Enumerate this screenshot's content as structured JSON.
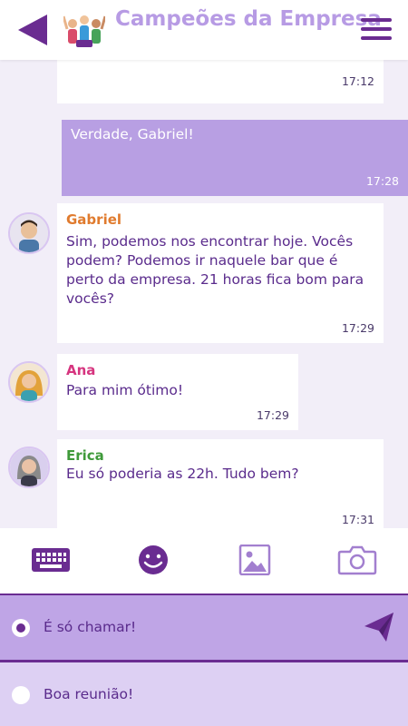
{
  "header": {
    "title": "Campeões da Empresa",
    "back_icon": "back-arrow-icon",
    "menu_icon": "hamburger-menu-icon",
    "accent_color": "#6a2c91",
    "title_color": "#b79be4"
  },
  "messages": [
    {
      "sender": "",
      "text": "",
      "time": "17:12",
      "outgoing": false
    },
    {
      "sender": "",
      "text": "Verdade, Gabriel!",
      "time": "17:28",
      "outgoing": true
    },
    {
      "sender": "Gabriel",
      "sender_color": "#e07b2e",
      "text": "Sim, podemos nos encontrar hoje. Vocês podem? Podemos ir naquele bar que é perto da empresa. 21 horas fica bom para vocês?",
      "time": "17:29",
      "outgoing": false
    },
    {
      "sender": "Ana",
      "sender_color": "#d6357f",
      "text": "Para mim ótimo!",
      "time": "17:29",
      "outgoing": false
    },
    {
      "sender": "Erica",
      "sender_color": "#3f9a3a",
      "text": "Eu só poderia as 22h. Tudo bem?",
      "time": "17:31",
      "outgoing": false
    }
  ],
  "toolbar": {
    "items": [
      "keyboard-icon",
      "emoji-icon",
      "image-icon",
      "camera-icon"
    ]
  },
  "reply_options": [
    {
      "label": "É só chamar!",
      "selected": true
    },
    {
      "label": "Boa reunião!",
      "selected": false
    }
  ]
}
